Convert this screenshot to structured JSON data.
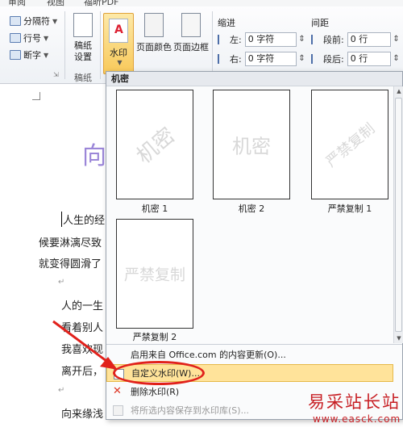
{
  "ribbon": {
    "tabs": [
      "审阅",
      "视图",
      "福昕PDF"
    ],
    "page_setup": {
      "breaks": "分隔符",
      "line_numbers": "行号",
      "hyphenation": "断字"
    },
    "manuscript": {
      "button": "稿纸\n设置",
      "group": "稿纸"
    },
    "page_background": {
      "watermark": "水印",
      "page_color": "页面颜色",
      "page_borders": "页面边框"
    },
    "indent": {
      "title": "缩进",
      "left_label": "左:",
      "left_value": "0 字符",
      "right_label": "右:",
      "right_value": "0 字符"
    },
    "spacing": {
      "title": "间距",
      "before_label": "段前:",
      "before_value": "0 行",
      "after_label": "段后:",
      "after_value": "0 行"
    }
  },
  "document": {
    "title_fragment": "向",
    "lines": [
      "人生的经",
      "候要淋漓尽致",
      "就变得圆滑了",
      "人的一生",
      "看着别人",
      "我喜欢现",
      "离开后，",
      "向来缘浅"
    ]
  },
  "watermark_menu": {
    "category": "机密",
    "items": [
      {
        "label": "机密 1",
        "text": "机密"
      },
      {
        "label": "机密 2",
        "text": "机密"
      },
      {
        "label": "严禁复制 1",
        "text": "严禁复制"
      },
      {
        "label": "严禁复制 2",
        "text": "严禁复制"
      }
    ],
    "actions": {
      "office_update": "启用来自 Office.com 的内容更新(O)...",
      "custom": "自定义水印(W)...",
      "remove": "删除水印(R)",
      "save_selection": "将所选内容保存到水印库(S)..."
    }
  },
  "site_logo": {
    "name": "易采站长站",
    "url": "www.easck.com"
  },
  "colors": {
    "highlight": "#ffe39a",
    "annotation": "#e1211b",
    "logo": "#c71f24"
  }
}
